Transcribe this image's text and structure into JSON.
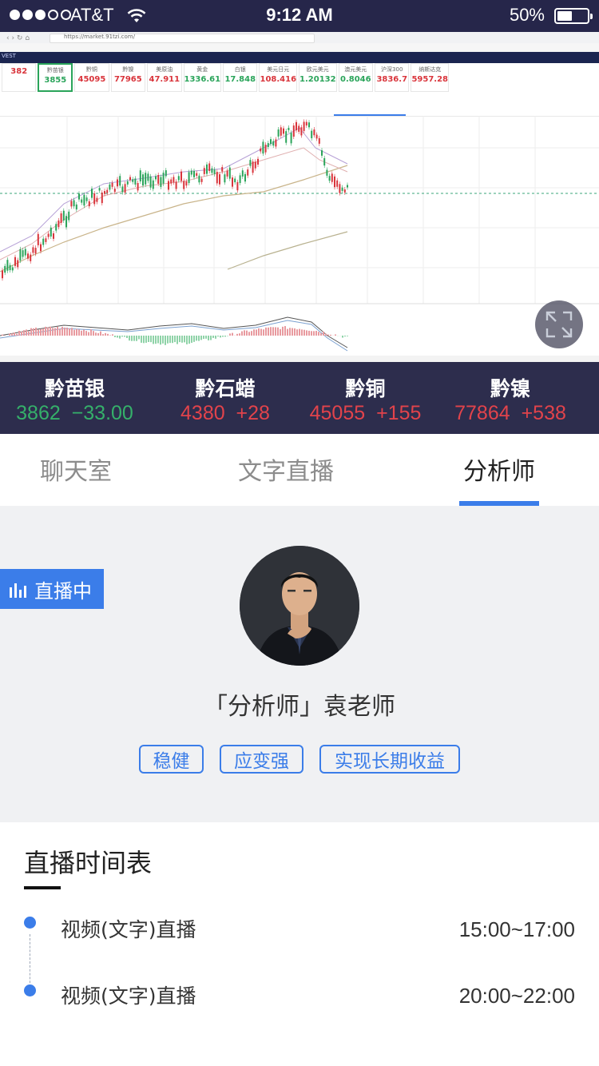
{
  "status_bar": {
    "carrier": "AT&T",
    "time": "9:12 AM",
    "battery": "50%",
    "signal_bars_filled": 3,
    "signal_bars_total": 5,
    "battery_level": 0.5
  },
  "chart_snapshot": {
    "url": "https://market.91tzi.com/",
    "mini_quotes": [
      {
        "name": "",
        "value": "382",
        "up": false
      },
      {
        "name": "黔苗银",
        "value": "3855",
        "up": true
      },
      {
        "name": "黔铜",
        "value": "45095",
        "up": false
      },
      {
        "name": "黔镍",
        "value": "77965",
        "up": false
      },
      {
        "name": "美原油",
        "value": "47.911",
        "up": false
      },
      {
        "name": "黄金",
        "value": "1336.61",
        "up": true
      },
      {
        "name": "白银",
        "value": "17.848",
        "up": true
      },
      {
        "name": "美元日元",
        "value": "108.416",
        "up": false
      },
      {
        "name": "欧元美元",
        "value": "1.20132",
        "up": true
      },
      {
        "name": "澳元美元",
        "value": "0.8046",
        "up": true
      },
      {
        "name": "沪深300",
        "value": "3836.7",
        "up": false
      },
      {
        "name": "纳斯达克",
        "value": "5957.28",
        "up": false
      }
    ]
  },
  "ticker": [
    {
      "name": "黔苗银",
      "price": "3862",
      "change": "−33.00",
      "color": "#35b06a"
    },
    {
      "name": "黔石蜡",
      "price": "4380",
      "change": "+28",
      "color": "#e2434b"
    },
    {
      "name": "黔铜",
      "price": "45055",
      "change": "+155",
      "color": "#e2434b"
    },
    {
      "name": "黔镍",
      "price": "77864",
      "change": "+538",
      "color": "#e2434b"
    }
  ],
  "tabs": [
    {
      "label": "聊天室",
      "active": false
    },
    {
      "label": "文字直播",
      "active": false
    },
    {
      "label": "分析师",
      "active": true
    }
  ],
  "profile": {
    "live_badge": "直播中",
    "name": "「分析师」袁老师",
    "tags": [
      "稳健",
      "应变强",
      "实现长期收益"
    ]
  },
  "schedule": {
    "title": "直播时间表",
    "rows": [
      {
        "label": "视频(文字)直播",
        "time": "15:00~17:00"
      },
      {
        "label": "视频(文字)直播",
        "time": "20:00~22:00"
      }
    ]
  },
  "colors": {
    "accent": "#3b7de9",
    "header_bg": "#2d2d4d",
    "up_green": "#35b06a",
    "down_red": "#e2434b"
  }
}
